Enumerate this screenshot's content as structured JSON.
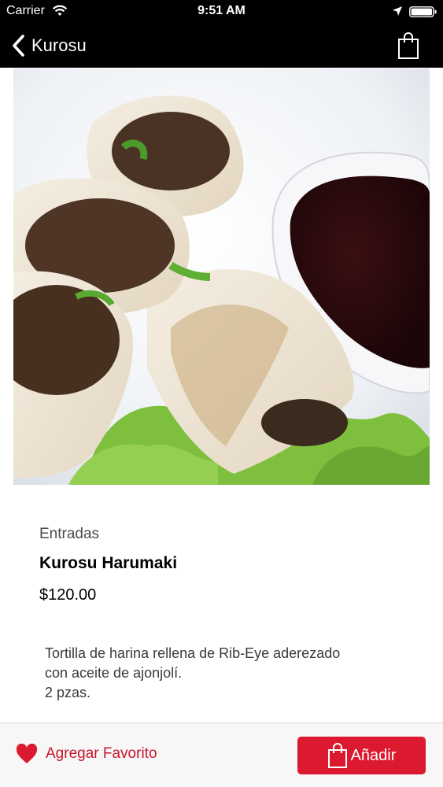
{
  "status_bar": {
    "carrier": "Carrier",
    "time": "9:51 AM"
  },
  "nav": {
    "back_label": "Kurosu"
  },
  "product": {
    "category": "Entradas",
    "name": "Kurosu Harumaki",
    "price": "$120.00",
    "description_lines": [
      "Tortilla de harina rellena de Rib-Eye aderezado",
      "con aceite de ajonjolí.",
      "2 pzas."
    ]
  },
  "actions": {
    "favorite_label": "Agregar Favorito",
    "add_label": "Añadir"
  },
  "colors": {
    "accent": "#dc1a2f",
    "favorite": "#c8152b",
    "bar": "#000000"
  },
  "icons": {
    "back": "chevron-left-icon",
    "cart": "shopping-bag-icon",
    "favorite": "heart-icon",
    "add": "shopping-bag-icon"
  }
}
